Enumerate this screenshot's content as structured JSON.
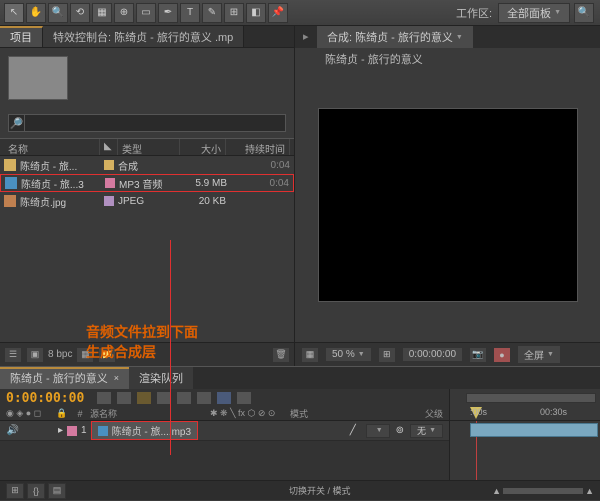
{
  "toolbar": {
    "workspace_label": "工作区:",
    "workspace_value": "全部面板"
  },
  "project": {
    "tab_project": "项目",
    "tab_effects": "特效控制台: 陈绮贞 - 旅行的意义 .mp",
    "search_placeholder": "",
    "columns": {
      "name": "名称",
      "label": "",
      "type": "类型",
      "size": "大小",
      "duration": "持续时间"
    },
    "assets": [
      {
        "name": "陈绮贞 - 旅...",
        "color": "#d4b060",
        "type": "合成",
        "size": "",
        "duration": "0:04",
        "icon": "#d4b060"
      },
      {
        "name": "陈绮贞 - 旅...3",
        "color": "#d47aa0",
        "type": "MP3 音频",
        "size": "5.9 MB",
        "duration": "0:04",
        "icon": "#4a90c0",
        "highlight": true
      },
      {
        "name": "陈绮贞.jpg",
        "color": "#b090c0",
        "type": "JPEG",
        "size": "20 KB",
        "duration": "",
        "icon": "#c08050"
      }
    ],
    "footer_bpc": "8 bpc"
  },
  "annotation": {
    "line1": "音频文件拉到下面",
    "line2": "生成合成层"
  },
  "viewer": {
    "tab_comp": "合成: 陈绮贞 - 旅行的意义",
    "breadcrumb": "陈绮贞 - 旅行的意义",
    "zoom": "50 %",
    "time": "0:00:00:00",
    "full": "全屏"
  },
  "timeline": {
    "tab_comp": "陈绮贞 - 旅行的意义",
    "tab_render": "渲染队列",
    "timecode": "0:00:00:00",
    "cols": {
      "source": "源名称",
      "mode": "模式",
      "parent": "父级"
    },
    "ruler": {
      "t0": ":00s",
      "t1": "00:30s"
    },
    "layer": {
      "index": "1",
      "name": "陈绮贞 - 旅....mp3",
      "mode_none": "无"
    },
    "footer_switches": "切换开关 / 模式"
  }
}
